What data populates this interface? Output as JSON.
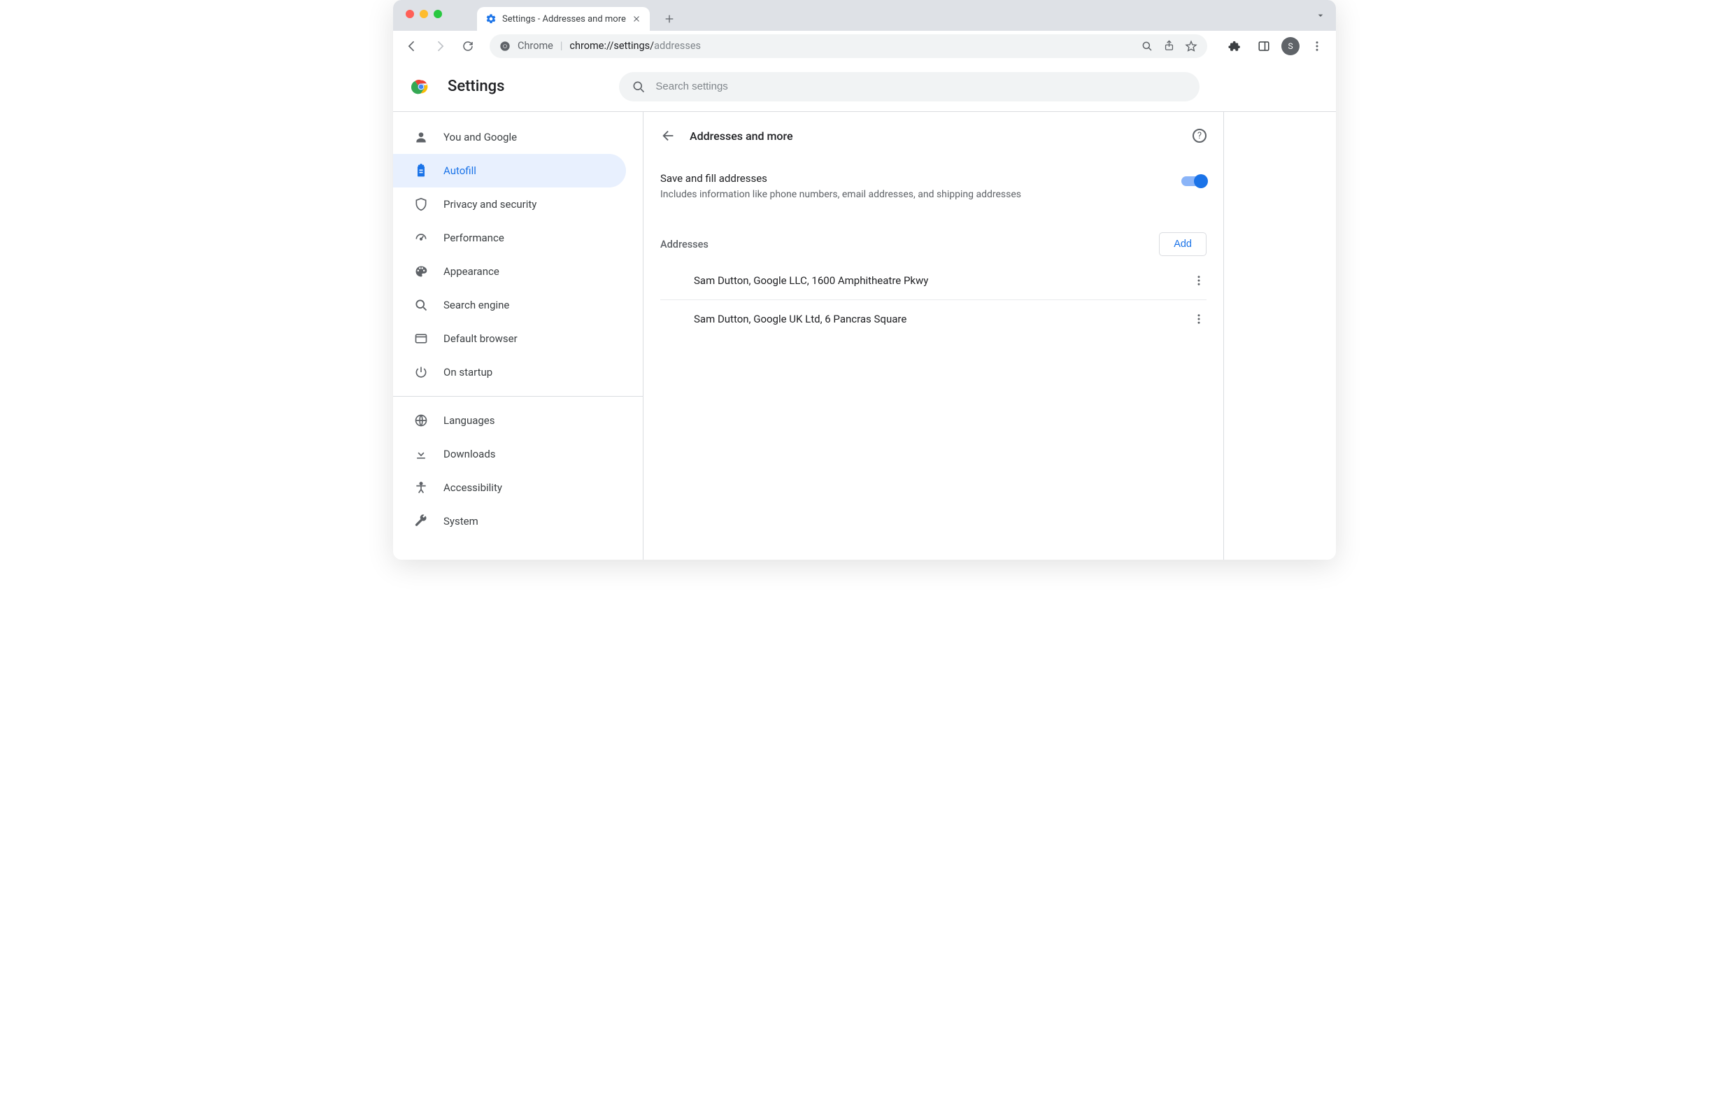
{
  "tab": {
    "title": "Settings - Addresses and more"
  },
  "omnibox": {
    "scheme_label": "Chrome",
    "url_strong": "chrome://settings/",
    "url_tail": "addresses"
  },
  "app": {
    "title": "Settings",
    "search_placeholder": "Search settings"
  },
  "sidebar": {
    "items": [
      {
        "label": "You and Google"
      },
      {
        "label": "Autofill"
      },
      {
        "label": "Privacy and security"
      },
      {
        "label": "Performance"
      },
      {
        "label": "Appearance"
      },
      {
        "label": "Search engine"
      },
      {
        "label": "Default browser"
      },
      {
        "label": "On startup"
      }
    ],
    "items2": [
      {
        "label": "Languages"
      },
      {
        "label": "Downloads"
      },
      {
        "label": "Accessibility"
      },
      {
        "label": "System"
      }
    ]
  },
  "page": {
    "title": "Addresses and more",
    "save_fill_title": "Save and fill addresses",
    "save_fill_sub": "Includes information like phone numbers, email addresses, and shipping addresses",
    "addresses_label": "Addresses",
    "add_label": "Add",
    "addresses": [
      {
        "text": "Sam Dutton, Google LLC, 1600 Amphitheatre Pkwy"
      },
      {
        "text": "Sam Dutton, Google UK Ltd, 6 Pancras Square"
      }
    ]
  },
  "avatar_letter": "S"
}
